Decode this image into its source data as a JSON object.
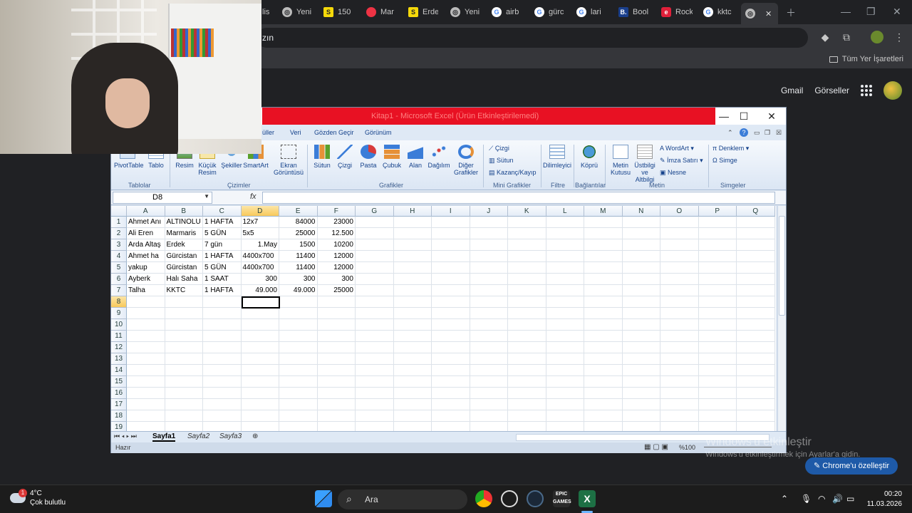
{
  "browser": {
    "tabs": [
      {
        "label": "lis",
        "icon": "webpage-icon"
      },
      {
        "label": "Yeni",
        "icon": "webpage-icon"
      },
      {
        "label": "150",
        "icon": "s-icon"
      },
      {
        "label": "Mar",
        "icon": "webpage-icon"
      },
      {
        "label": "Erde",
        "icon": "s-icon"
      },
      {
        "label": "Yeni",
        "icon": "webpage-icon"
      },
      {
        "label": "airb",
        "icon": "google-icon"
      },
      {
        "label": "gürc",
        "icon": "google-icon"
      },
      {
        "label": "lari",
        "icon": "google-icon"
      },
      {
        "label": "Bool",
        "icon": "booking-icon"
      },
      {
        "label": "Rock",
        "icon": "e-icon"
      },
      {
        "label": "kktc",
        "icon": "google-icon"
      }
    ],
    "omnibox_text": "zın",
    "bookmarks_label": "Tüm Yer İşaretleri",
    "google_links": [
      "Gmail",
      "Görseller"
    ],
    "customize_label": "Chrome'u özelleştir",
    "colors": {
      "background": "#202124",
      "toolbar": "#35363a"
    }
  },
  "excel": {
    "title": "Kitap1 - Microsoft Excel (Ürün Etkinleştirilemedi)",
    "ribbon_tabs": [
      "üller",
      "Veri",
      "Gözden Geçir",
      "Görünüm"
    ],
    "ribbon_buttons": [
      "PivotTable",
      "Tablo",
      "Resim",
      "Küçük Resim",
      "Şekiller",
      "SmartArt",
      "Ekran Görüntüsü",
      "Sütun",
      "Çizgi",
      "Pasta",
      "Çubuk",
      "Alan",
      "Dağılım",
      "Diğer Grafikler",
      "Dilimleyici",
      "Köprü",
      "Metin Kutusu",
      "Üstbilgi ve Altbilgi"
    ],
    "mini_charts": [
      "Çizgi",
      "Sütun",
      "Kazanç/Kayıp"
    ],
    "text_items": [
      "WordArt",
      "İmza Satırı",
      "Nesne"
    ],
    "symbol_items": [
      "Denklem",
      "Simge"
    ],
    "groups": [
      "Tablolar",
      "Çizimler",
      "Grafikler",
      "Mini Grafikler",
      "Filtre",
      "Bağlantılar",
      "Metin",
      "Simgeler"
    ],
    "name_box": "D8",
    "fx": "fx",
    "columns": [
      "A",
      "B",
      "C",
      "D",
      "E",
      "F",
      "G",
      "H",
      "I",
      "J",
      "K",
      "L",
      "M",
      "N",
      "O",
      "P",
      "Q"
    ],
    "selected_column": "D",
    "selected_row": 8,
    "rows": [
      [
        "Ahmet Anı",
        "ALTINOLU",
        "1 HAFTA",
        "12x7",
        "84000",
        "23000"
      ],
      [
        "Ali Eren",
        "Marmaris",
        "5 GÜN",
        "5x5",
        "25000",
        "12.500"
      ],
      [
        "Arda Altaş",
        "Erdek",
        "7 gün",
        "1.May",
        "1500",
        "10200"
      ],
      [
        "Ahmet ha",
        "Gürcistan",
        "1 HAFTA",
        "4400x700",
        "11400",
        "12000"
      ],
      [
        "yakup",
        "Gürcistan",
        "5 GÜN",
        "4400x700",
        "11400",
        "12000"
      ],
      [
        "Ayberk",
        "Halı Saha",
        "1 SAAT",
        "300",
        "300",
        "300"
      ],
      [
        "Talha",
        "KKTC",
        "1 HAFTA",
        "49.000",
        "49.000",
        "25000"
      ]
    ],
    "row_numbers": [
      1,
      2,
      3,
      4,
      5,
      6,
      7,
      8,
      9,
      10,
      11,
      12,
      13,
      14,
      15,
      16,
      17,
      18,
      19
    ],
    "sheets": [
      "Sayfa1",
      "Sayfa2",
      "Sayfa3"
    ],
    "active_sheet": "Sayfa1",
    "status": "Hazır",
    "zoom": "%100"
  },
  "watermark": {
    "line1": "Windows'u etkinleştir",
    "line2": "Windows'u etkinleştirmek için Ayarlar'a gidin."
  },
  "taskbar": {
    "weather_temp": "4°C",
    "weather_desc": "Çok bulutlu",
    "weather_badge": "1",
    "search_label": "Ara",
    "time": "00:20",
    "date": "11.03.2026"
  }
}
